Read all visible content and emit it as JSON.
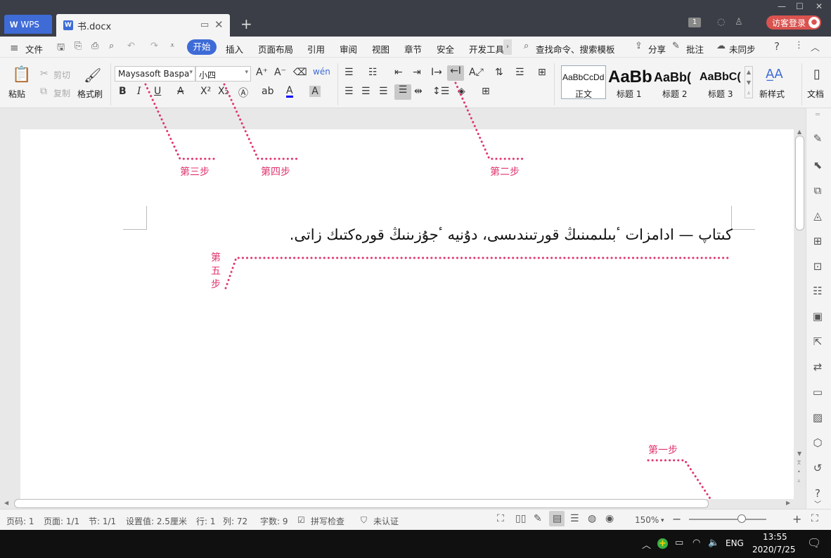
{
  "titlebar": {
    "app_tab": "WPS",
    "doc_tab": "书.docx",
    "doc_icon": "W",
    "badge_count": "1",
    "login_label": "访客登录"
  },
  "menubar": {
    "file": "文件",
    "active_tab": "开始",
    "tabs": [
      "插入",
      "页面布局",
      "引用",
      "审阅",
      "视图",
      "章节",
      "安全",
      "开发工具"
    ],
    "search": "查找命令、搜索模板",
    "share": "分享",
    "comment": "批注",
    "sync": "未同步"
  },
  "ribbon": {
    "paste": "粘贴",
    "cut": "剪切",
    "copy": "复制",
    "format_painter": "格式刷",
    "font_name": "Maysasoft Baspa",
    "font_size": "小四",
    "styles": [
      {
        "preview": "AaBbCcDd",
        "name": "正文"
      },
      {
        "preview": "AaBb",
        "name": "标题 1"
      },
      {
        "preview": "AaBb(",
        "name": "标题 2"
      },
      {
        "preview": "AaBbC(",
        "name": "标题 3"
      }
    ],
    "new_style": "新样式",
    "doc_helper": "文档"
  },
  "document": {
    "text": "كىتاپ — ادامزات ٴبىلىمىنىڭ قورتىندىسى، دۇنيە ٴجۇزىنىڭ قورەكتىك زاتى."
  },
  "annotations": {
    "step1": "第一步",
    "step2": "第二步",
    "step3": "第三步",
    "step4": "第四步",
    "step5_chars": [
      "第",
      "五",
      "步"
    ],
    "color": "#e0336f"
  },
  "statusbar": {
    "page_num": "页码: 1",
    "pages": "页面: 1/1",
    "section": "节: 1/1",
    "setting": "设置值: 2.5厘米",
    "row": "行: 1",
    "col": "列: 72",
    "word_count": "字数: 9",
    "spell_check": "拼写检查",
    "certify": "未认证",
    "zoom": "150%"
  },
  "taskbar": {
    "lang": "ENG",
    "time": "13:55",
    "date": "2020/7/25"
  },
  "colors": {
    "accent": "#3e6bd6",
    "titlebar": "#3b3e47",
    "login": "#d9534f"
  }
}
